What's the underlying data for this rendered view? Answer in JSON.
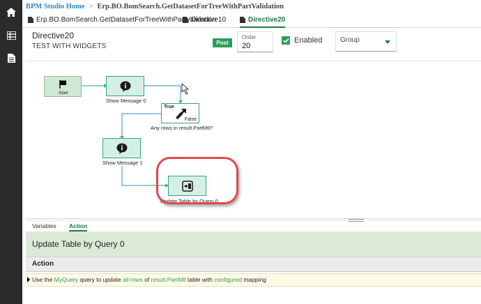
{
  "breadcrumb": {
    "home": "BPM Studio Home",
    "separator": ">",
    "current": "Erp.BO.BomSearch.GetDatasetForTreeWithPartValidation"
  },
  "tabs": [
    {
      "label": "Erp.BO.BomSearch.GetDatasetForTreeWithPartValidation",
      "active": false,
      "icon": "document-icon"
    },
    {
      "label": "Directive10",
      "active": false,
      "icon": "document-icon"
    },
    {
      "label": "Directive20",
      "active": true,
      "icon": "document-icon"
    }
  ],
  "directive": {
    "name": "Directive20",
    "description": "TEST WITH WIDGETS",
    "badge": "Post",
    "order_label": "Order",
    "order_value": "20",
    "enabled_label": "Enabled",
    "enabled": true,
    "group_label": "Group"
  },
  "workflow": {
    "nodes": [
      {
        "id": "start",
        "label": "Start",
        "icon": "flag-icon"
      },
      {
        "id": "show1",
        "label": "Show Message 0",
        "icon": "speech-bubble-icon"
      },
      {
        "id": "cond",
        "label": "Any rows in result.PartMtl?",
        "icon": "decision-icon",
        "true_label": "True",
        "false_label": "False"
      },
      {
        "id": "show2",
        "label": "Show Message 1",
        "icon": "speech-bubble-icon"
      },
      {
        "id": "update",
        "label": "Update Table by Query 0",
        "icon": "update-table-icon"
      }
    ]
  },
  "bottom_tabs": [
    {
      "label": "Variables",
      "active": false
    },
    {
      "label": "Action",
      "active": true
    }
  ],
  "action": {
    "title": "Update Table by Query 0",
    "column_header": "Action",
    "sentence": {
      "p1": "Use the ",
      "query": "MyQuery",
      "p2": " query to update ",
      "rows": "all rows",
      "p3": " of ",
      "table": "result.PartMtl",
      "p4": " table with ",
      "mapping": "configured",
      "p5": " mapping"
    }
  },
  "colors": {
    "sidebar": "#2b2b2b",
    "accent_green": "#2e9c5a",
    "node_fill": "#d6efe6",
    "node_border": "#31a385",
    "callout": "#dd4b4b",
    "link_blue": "#2e86c1"
  }
}
